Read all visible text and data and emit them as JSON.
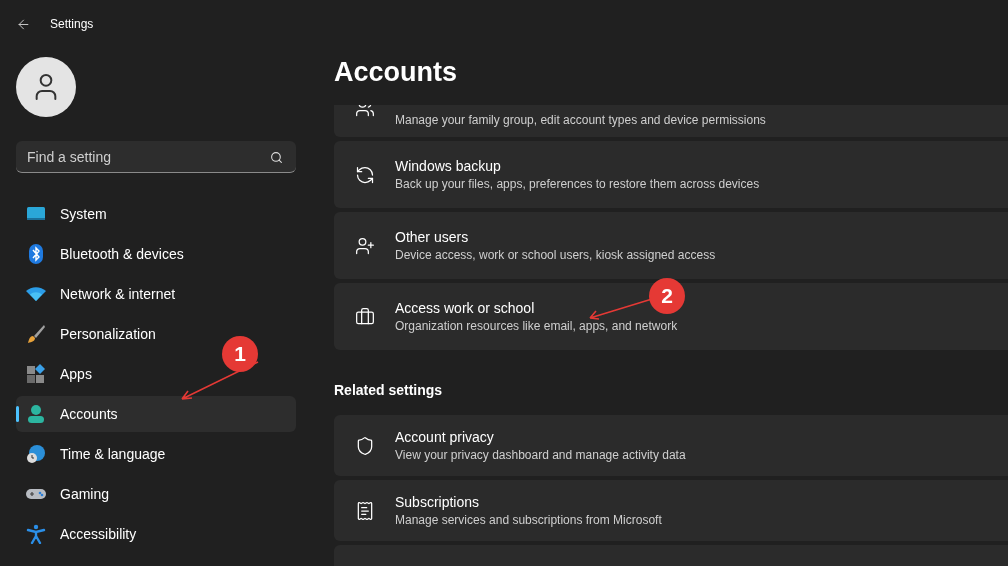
{
  "window": {
    "title": "Settings"
  },
  "search": {
    "placeholder": "Find a setting"
  },
  "nav": [
    {
      "label": "System",
      "selected": false
    },
    {
      "label": "Bluetooth & devices",
      "selected": false
    },
    {
      "label": "Network & internet",
      "selected": false
    },
    {
      "label": "Personalization",
      "selected": false
    },
    {
      "label": "Apps",
      "selected": false
    },
    {
      "label": "Accounts",
      "selected": true
    },
    {
      "label": "Time & language",
      "selected": false
    },
    {
      "label": "Gaming",
      "selected": false
    },
    {
      "label": "Accessibility",
      "selected": false
    }
  ],
  "page": {
    "title": "Accounts"
  },
  "cards": [
    {
      "kind": "clipped",
      "description": "Manage your family group, edit account types and device permissions"
    },
    {
      "kind": "full",
      "title": "Windows backup",
      "description": "Back up your files, apps, preferences to restore them across devices"
    },
    {
      "kind": "full",
      "title": "Other users",
      "description": "Device access, work or school users, kiosk assigned access"
    },
    {
      "kind": "full",
      "title": "Access work or school",
      "description": "Organization resources like email, apps, and network"
    }
  ],
  "related": {
    "heading": "Related settings",
    "cards": [
      {
        "kind": "full",
        "title": "Account privacy",
        "description": "View your privacy dashboard and manage activity data"
      },
      {
        "kind": "full",
        "title": "Subscriptions",
        "description": "Manage services and subscriptions from Microsoft"
      },
      {
        "kind": "empty"
      }
    ]
  },
  "annotations": [
    {
      "label": "1"
    },
    {
      "label": "2"
    }
  ]
}
